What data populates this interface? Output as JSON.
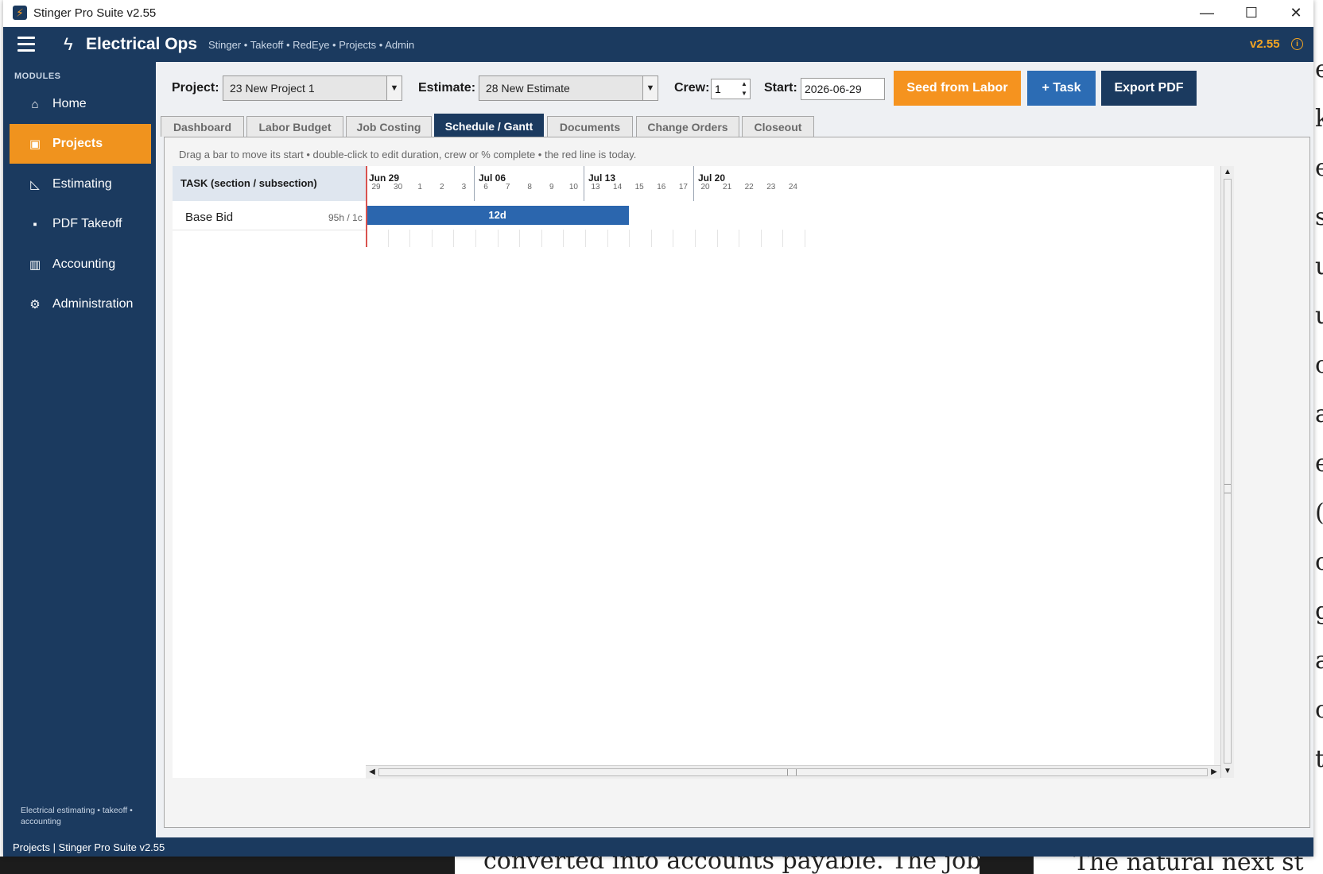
{
  "window": {
    "title": "Stinger Pro Suite v2.55",
    "controls": {
      "minimize": "—",
      "maximize": "☐",
      "close": "✕"
    }
  },
  "header": {
    "brand": "Electrical Ops",
    "breadcrumbs": "Stinger • Takeoff • RedEye • Projects • Admin",
    "version": "v2.55",
    "icons": {
      "menu": "hamburger-icon",
      "brand": "bolt-icon",
      "info": "info-icon"
    }
  },
  "sidebar": {
    "section_label": "MODULES",
    "items": [
      {
        "label": "Home",
        "icon": "⌂",
        "icon_name": "home-icon",
        "active": false
      },
      {
        "label": "Projects",
        "icon": "▣",
        "icon_name": "projects-icon",
        "active": true
      },
      {
        "label": "Estimating",
        "icon": "◺",
        "icon_name": "estimating-icon",
        "active": false
      },
      {
        "label": "PDF Takeoff",
        "icon": "▪",
        "icon_name": "pdf-takeoff-icon",
        "active": false
      },
      {
        "label": "Accounting",
        "icon": "▥",
        "icon_name": "accounting-icon",
        "active": false
      },
      {
        "label": "Administration",
        "icon": "⚙",
        "icon_name": "administration-icon",
        "active": false
      }
    ],
    "footer": "Electrical estimating • takeoff • accounting"
  },
  "toolbar": {
    "project_label": "Project:",
    "project_value": "23  New Project 1",
    "estimate_label": "Estimate:",
    "estimate_value": "28  New Estimate",
    "crew_label": "Crew:",
    "crew_value": "1",
    "start_label": "Start:",
    "start_value": "2026-06-29",
    "seed_button": "Seed from Labor",
    "task_button": "+ Task",
    "export_button": "Export PDF"
  },
  "tabs": [
    {
      "label": "Dashboard",
      "active": false
    },
    {
      "label": "Labor Budget",
      "active": false
    },
    {
      "label": "Job Costing",
      "active": false
    },
    {
      "label": "Schedule / Gantt",
      "active": true
    },
    {
      "label": "Documents",
      "active": false
    },
    {
      "label": "Change Orders",
      "active": false
    },
    {
      "label": "Closeout",
      "active": false
    }
  ],
  "gantt": {
    "hint": "Drag a bar to move its start • double-click to edit duration, crew or % complete • the red line is today.",
    "task_header": "TASK  (section / subsection)",
    "weeks": [
      "Jun 29",
      "Jul 06",
      "Jul 13",
      "Jul 20"
    ],
    "days": [
      "29",
      "30",
      "1",
      "2",
      "3",
      "6",
      "7",
      "8",
      "9",
      "10",
      "13",
      "14",
      "15",
      "16",
      "17",
      "20",
      "21",
      "22",
      "23",
      "24"
    ],
    "tasks": [
      {
        "name": "Base Bid",
        "meta": "95h / 1c",
        "bar_label": "12d",
        "start_day_index": 0,
        "duration_days": 12
      }
    ],
    "colors": {
      "bar": "#2b66ae",
      "today_line": "#d9534f"
    }
  },
  "statusbar": {
    "text": "Projects  |  Stinger Pro Suite v2.55"
  },
  "theme": {
    "navy": "#1b3a5f",
    "orange": "#f5931f",
    "blue": "#2c6cb4",
    "version_accent": "#f5a623"
  },
  "backdrop": {
    "right_letters": [
      "e",
      "k",
      "e",
      "s",
      "u",
      "u",
      "c",
      "a",
      "e",
      "(",
      "c",
      "g",
      "a",
      "c",
      "t"
    ],
    "bottom_doc_1": "converted into accounts payable. The job",
    "bottom_doc_2": "The natural next st"
  }
}
